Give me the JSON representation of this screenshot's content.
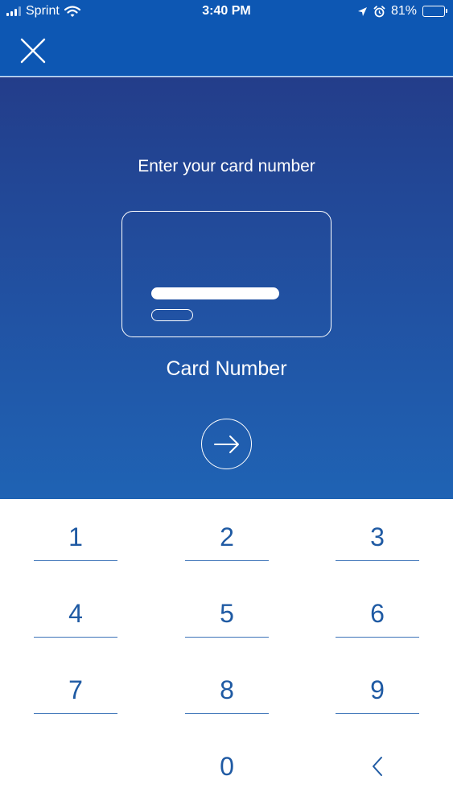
{
  "status_bar": {
    "carrier": "Sprint",
    "time": "3:40 PM",
    "battery": "81%",
    "battery_level": 0.81,
    "icons": [
      "signal-icon",
      "wifi-icon",
      "location-icon",
      "alarm-icon",
      "battery-icon"
    ]
  },
  "header": {
    "close_icon": "close-icon"
  },
  "main": {
    "prompt": "Enter your card number",
    "card_label": "Card Number",
    "next_icon": "arrow-right-icon"
  },
  "keypad": {
    "keys": [
      "1",
      "2",
      "3",
      "4",
      "5",
      "6",
      "7",
      "8",
      "9",
      "0"
    ],
    "backspace_icon": "chevron-left-icon"
  },
  "colors": {
    "header": "#0d57b3",
    "hero_top": "#233d8a",
    "hero_bottom": "#1f63b4",
    "key_text": "#1f5aa3",
    "battery": "#f5d22c"
  }
}
